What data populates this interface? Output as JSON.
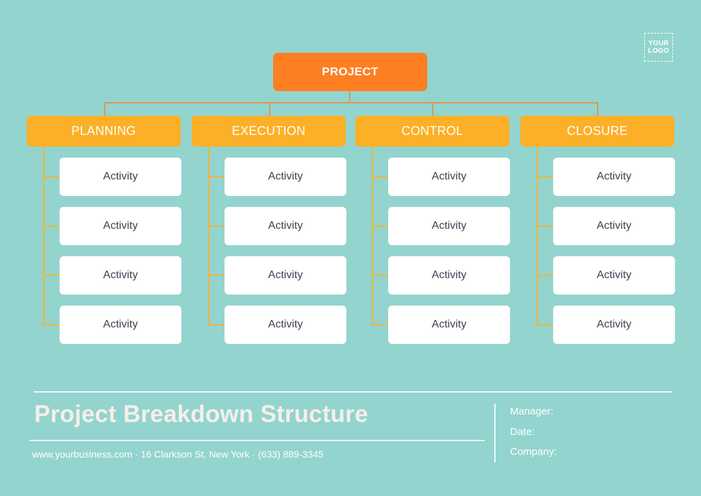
{
  "logo": {
    "line1": "YOUR",
    "line2": "LOGO"
  },
  "root": {
    "label": "PROJECT"
  },
  "phases": [
    {
      "label": "PLANNING",
      "activities": [
        "Activity",
        "Activity",
        "Activity",
        "Activity"
      ]
    },
    {
      "label": "EXECUTION",
      "activities": [
        "Activity",
        "Activity",
        "Activity",
        "Activity"
      ]
    },
    {
      "label": "CONTROL",
      "activities": [
        "Activity",
        "Activity",
        "Activity",
        "Activity"
      ]
    },
    {
      "label": "CLOSURE",
      "activities": [
        "Activity",
        "Activity",
        "Activity",
        "Activity"
      ]
    }
  ],
  "footer": {
    "title": "Project Breakdown Structure",
    "contact": "www.yourbusiness.com · 16 Clarkson St, New York · (633) 889-3345",
    "fields": [
      "Manager:",
      "Date:",
      "Company:"
    ]
  },
  "colors": {
    "background": "#93d4ce",
    "root": "#fd7f22",
    "phase": "#fbb027",
    "connector": "#d69a53",
    "activity_text": "#3c4250"
  }
}
